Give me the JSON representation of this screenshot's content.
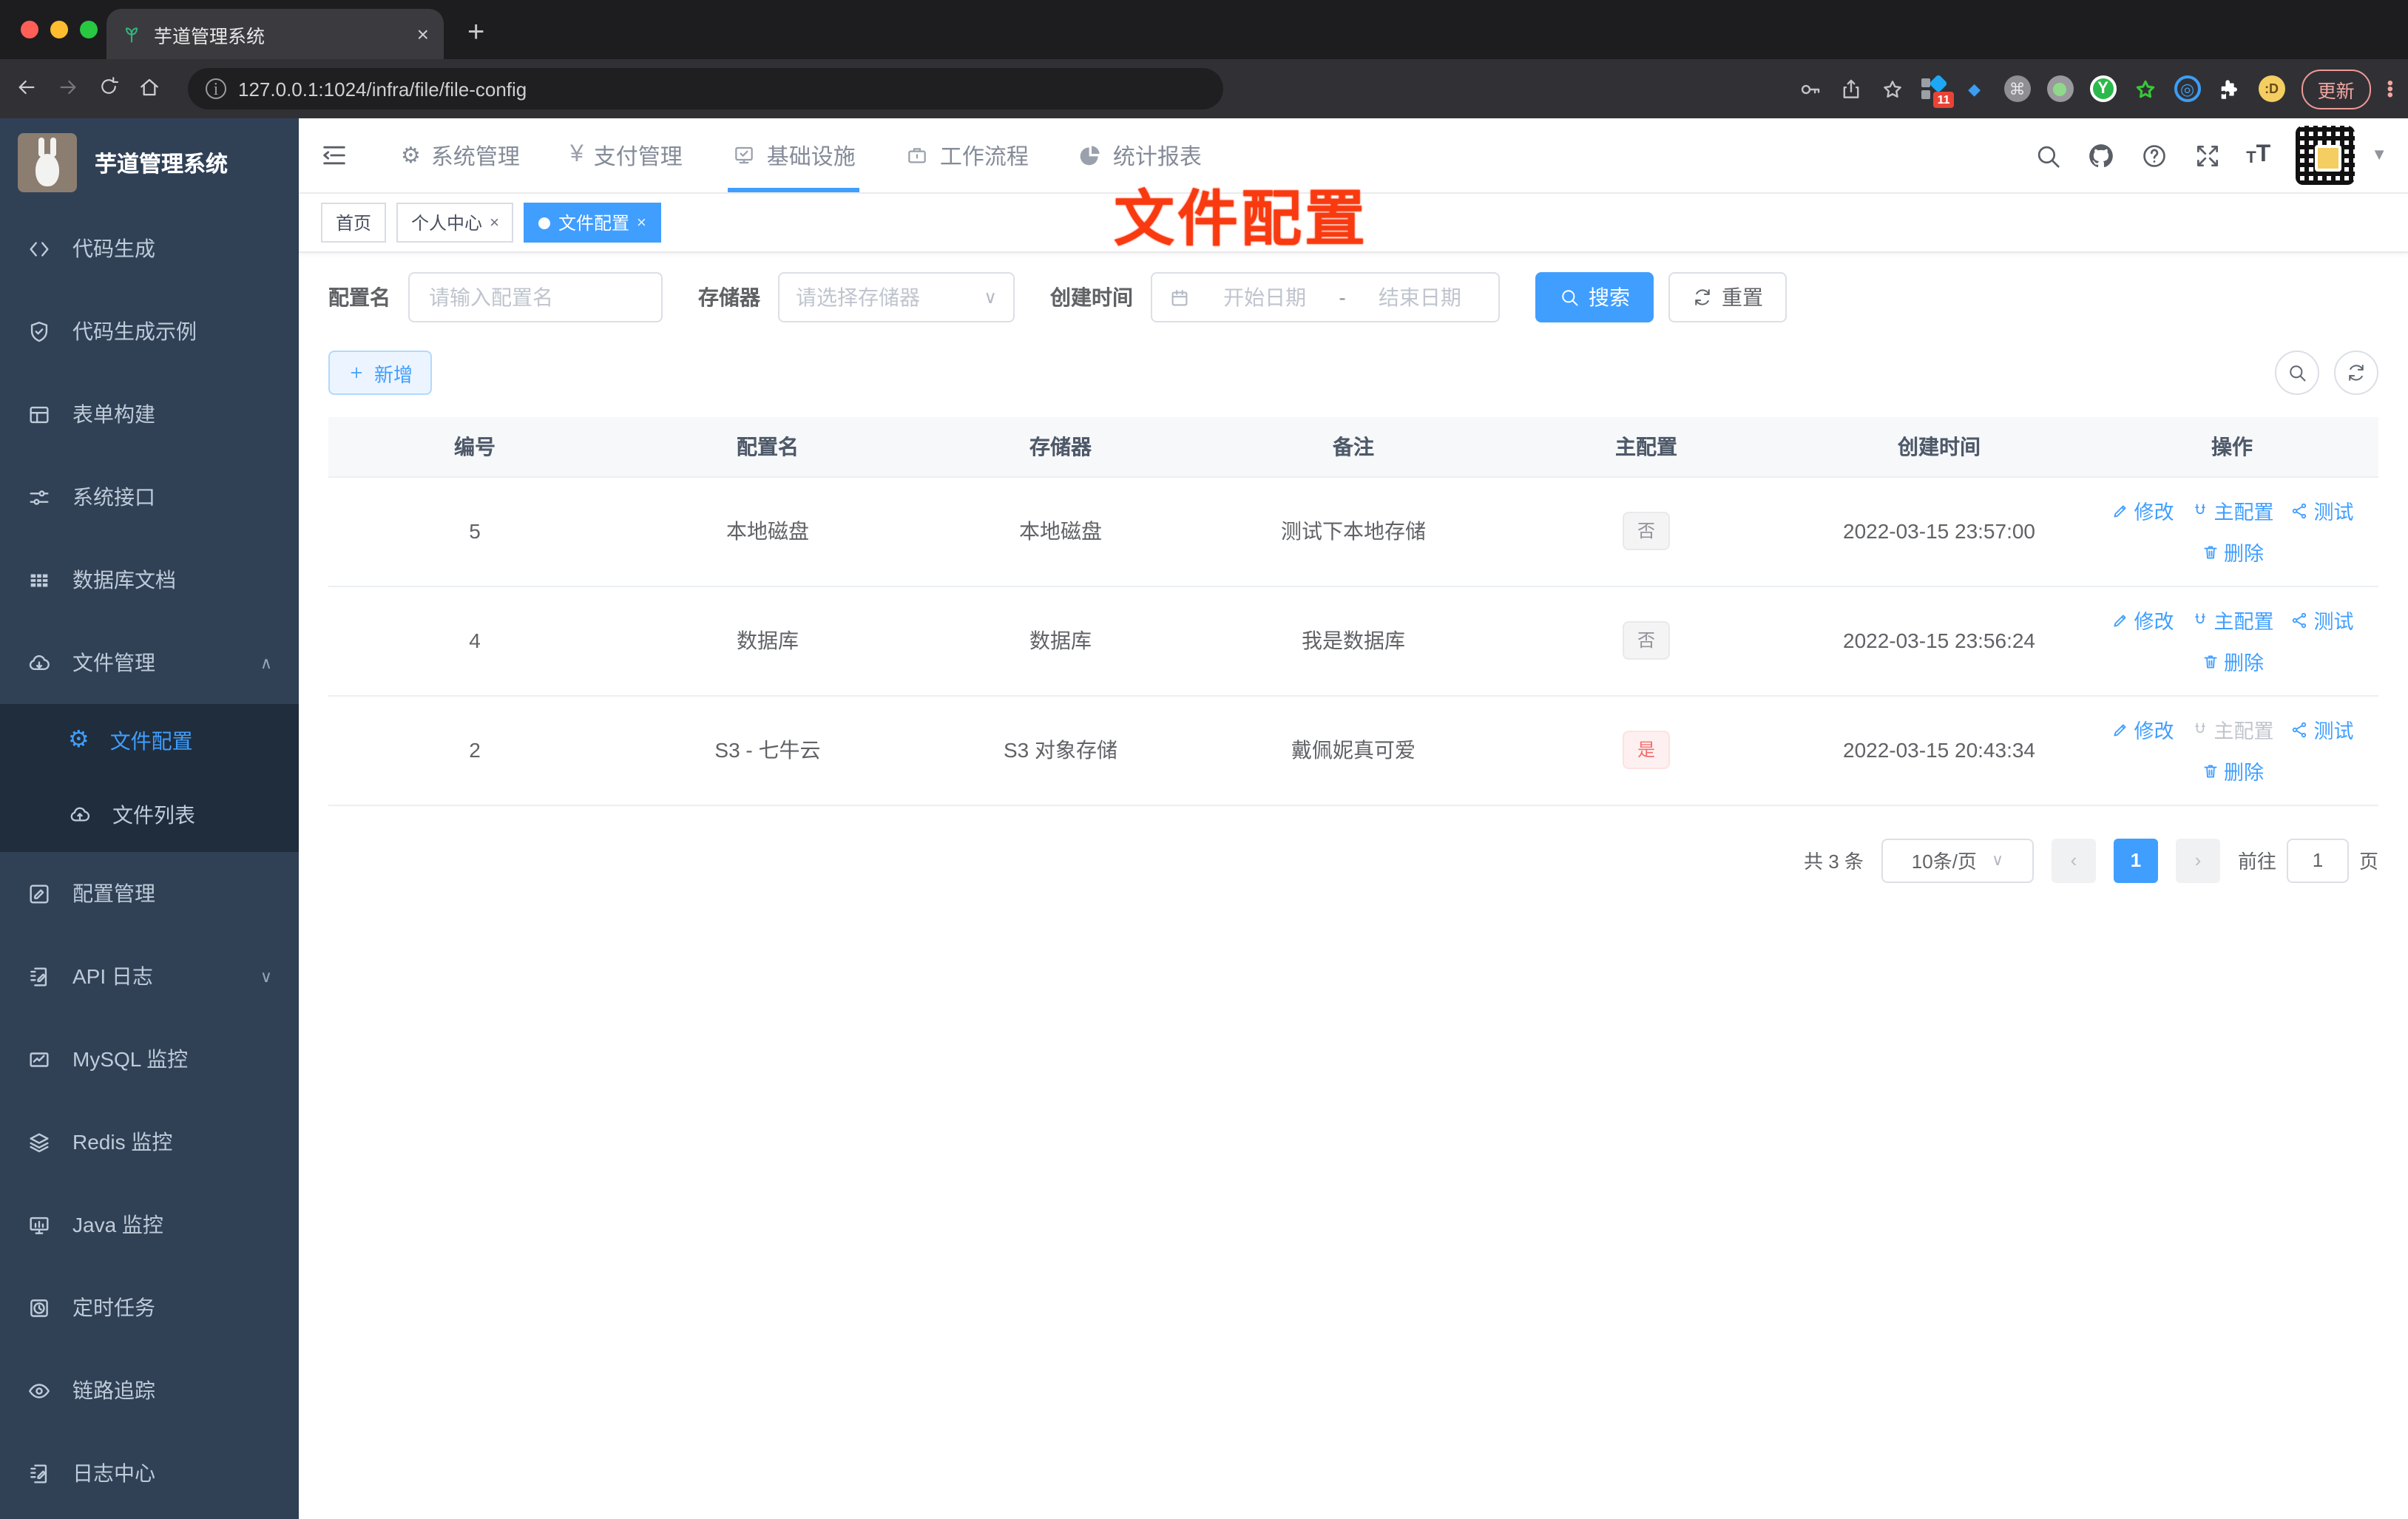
{
  "browser": {
    "tab_title": "芋道管理系统",
    "url": "127.0.0.1:1024/infra/file/file-config",
    "extension_badge": "11",
    "update_label": "更新"
  },
  "sidebar": {
    "app_title": "芋道管理系统",
    "items_top": [
      {
        "label": "代码生成"
      },
      {
        "label": "代码生成示例"
      },
      {
        "label": "表单构建"
      },
      {
        "label": "系统接口"
      },
      {
        "label": "数据库文档"
      },
      {
        "label": "文件管理"
      }
    ],
    "submenu": [
      {
        "label": "文件配置"
      },
      {
        "label": "文件列表"
      }
    ],
    "items_bottom": [
      {
        "label": "配置管理"
      },
      {
        "label": "API 日志"
      },
      {
        "label": "MySQL 监控"
      },
      {
        "label": "Redis 监控"
      },
      {
        "label": "Java 监控"
      },
      {
        "label": "定时任务"
      },
      {
        "label": "链路追踪"
      },
      {
        "label": "日志中心"
      }
    ]
  },
  "topnav": {
    "items": [
      {
        "label": "系统管理"
      },
      {
        "label": "支付管理"
      },
      {
        "label": "基础设施"
      },
      {
        "label": "工作流程"
      },
      {
        "label": "统计报表"
      }
    ]
  },
  "tags": [
    {
      "label": "首页"
    },
    {
      "label": "个人中心"
    },
    {
      "label": "文件配置"
    }
  ],
  "annotation": "文件配置",
  "filters": {
    "name_label": "配置名",
    "name_placeholder": "请输入配置名",
    "storage_label": "存储器",
    "storage_placeholder": "请选择存储器",
    "date_label": "创建时间",
    "date_start": "开始日期",
    "date_sep": "-",
    "date_end": "结束日期",
    "search_label": "搜索",
    "reset_label": "重置"
  },
  "toolbar": {
    "add_label": "新增"
  },
  "table": {
    "headers": [
      "编号",
      "配置名",
      "存储器",
      "备注",
      "主配置",
      "创建时间",
      "操作"
    ],
    "actions": {
      "edit": "修改",
      "master": "主配置",
      "test": "测试",
      "delete": "删除"
    },
    "rows": [
      {
        "id": "5",
        "name": "本地磁盘",
        "storage": "本地磁盘",
        "remark": "测试下本地存储",
        "master": "否",
        "created": "2022-03-15 23:57:00"
      },
      {
        "id": "4",
        "name": "数据库",
        "storage": "数据库",
        "remark": "我是数据库",
        "master": "否",
        "created": "2022-03-15 23:56:24"
      },
      {
        "id": "2",
        "name": "S3 - 七牛云",
        "storage": "S3 对象存储",
        "remark": "戴佩妮真可爱",
        "master": "是",
        "created": "2022-03-15 20:43:34"
      }
    ]
  },
  "pagination": {
    "total": "共 3 条",
    "page_size": "10条/页",
    "current_page": "1",
    "goto_label": "前往",
    "goto_value": "1",
    "page_unit": "页"
  },
  "colors": {
    "primary": "#409eff",
    "danger": "#f56c6c",
    "sidebar": "#304156",
    "annotation": "#f93a10"
  }
}
